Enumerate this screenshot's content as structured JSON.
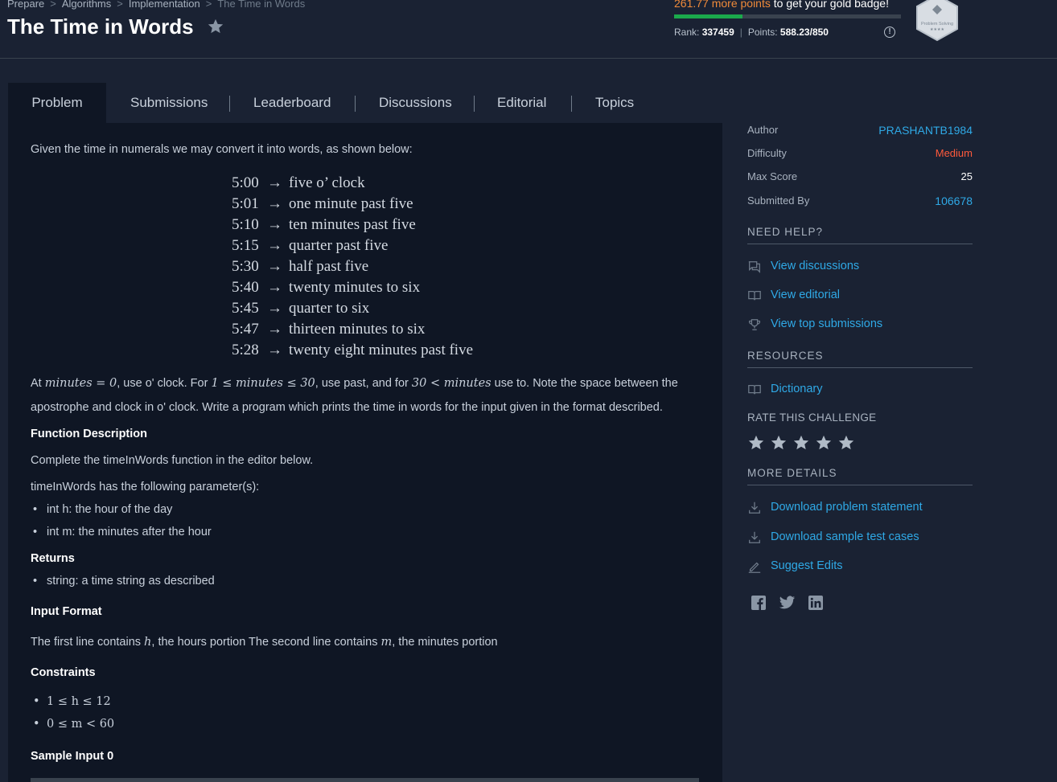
{
  "breadcrumb": [
    "Prepare",
    "Algorithms",
    "Implementation",
    "The Time in Words"
  ],
  "title": "The Time in Words",
  "badge": {
    "points_needed": "261.77 more points",
    "message": " to get your gold badge!",
    "progress_fraction": 0.3,
    "rank_label": "Rank:",
    "rank_value": "337459",
    "points_label": "Points:",
    "points_value": "588.23/850",
    "badge_name": "Problem Solving"
  },
  "tabs": [
    "Problem",
    "Submissions",
    "Leaderboard",
    "Discussions",
    "Editorial",
    "Topics"
  ],
  "problem": {
    "intro": "Given the time in numerals we may convert it into words, as shown below:",
    "examples": [
      {
        "time": "5:00",
        "words": "five o’ clock"
      },
      {
        "time": "5:01",
        "words": "one minute past five"
      },
      {
        "time": "5:10",
        "words": "ten minutes past five"
      },
      {
        "time": "5:15",
        "words": "quarter past five"
      },
      {
        "time": "5:30",
        "words": "half past five"
      },
      {
        "time": "5:40",
        "words": "twenty minutes to six"
      },
      {
        "time": "5:45",
        "words": "quarter to six"
      },
      {
        "time": "5:47",
        "words": "thirteen minutes to six"
      },
      {
        "time": "5:28",
        "words": "twenty eight minutes past five"
      }
    ],
    "arrow": "→",
    "rule_at": "At ",
    "rule_m0": "minutes = 0",
    "rule_a": ", use o' clock. For ",
    "rule_m1": "1 ≤ minutes ≤ 30",
    "rule_b": ", use past, and for ",
    "rule_m2": "30 < minutes",
    "rule_c": " use to. Note the space between the",
    "rule_line2": "apostrophe and clock in o' clock. Write a program which prints the time in words for the input given in the format described.",
    "function_heading": "Function Description",
    "function_text": "Complete the timeInWords function in the editor below.",
    "params_text": "timeInWords has the following parameter(s):",
    "params": [
      "int h: the hour of the day",
      "int m: the minutes after the hour"
    ],
    "returns_heading": "Returns",
    "returns": [
      "string: a time string as described"
    ],
    "input_heading": "Input Format",
    "input_a": "The first line contains ",
    "input_h": "h",
    "input_b": ", the hours portion The second line contains ",
    "input_m": "m",
    "input_c": ", the minutes portion",
    "constraints_heading": "Constraints",
    "constraints": [
      "1 ≤ h ≤ 12",
      "0 ≤ m < 60"
    ],
    "sample_heading": "Sample Input 0"
  },
  "sidebar": {
    "author_label": "Author",
    "author_value": "PRASHANTB1984",
    "difficulty_label": "Difficulty",
    "difficulty_value": "Medium",
    "maxscore_label": "Max Score",
    "maxscore_value": "25",
    "submitted_label": "Submitted By",
    "submitted_value": "106678",
    "need_help": "NEED HELP?",
    "help_links": [
      "View discussions",
      "View editorial",
      "View top submissions"
    ],
    "resources": "RESOURCES",
    "resource_links": [
      "Dictionary"
    ],
    "rate": "RATE THIS CHALLENGE",
    "stars": 5,
    "more_details": "MORE DETAILS",
    "detail_links": [
      "Download problem statement",
      "Download sample test cases",
      "Suggest Edits"
    ]
  },
  "colors": {
    "background": "#1a2233",
    "panel": "#0f1624",
    "link": "#2fa9e6",
    "medium": "#ff5a3c",
    "points": "#ef8a3a",
    "progress": "#1ba94c"
  }
}
